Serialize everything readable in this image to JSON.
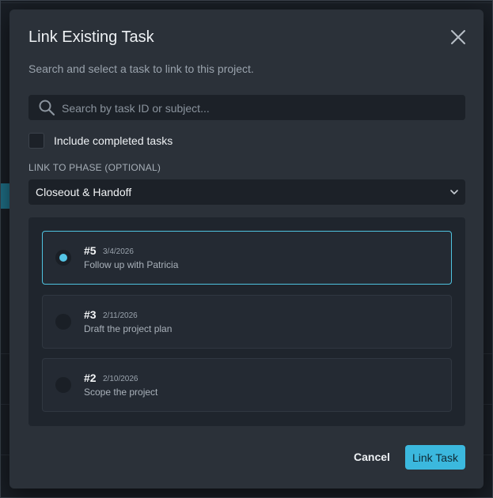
{
  "dialog": {
    "title": "Link Existing Task",
    "subtitle": "Search and select a task to link to this project.",
    "close_icon": "close-icon"
  },
  "search": {
    "placeholder": "Search by task ID or subject...",
    "value": "",
    "icon": "search-icon"
  },
  "include_completed": {
    "label": "Include completed tasks",
    "checked": false
  },
  "phase": {
    "label": "LINK TO PHASE (OPTIONAL)",
    "selected": "Closeout & Handoff",
    "icon": "chevron-down-icon"
  },
  "tasks": [
    {
      "id": "#5",
      "date": "3/4/2026",
      "subject": "Follow up with Patricia",
      "selected": true
    },
    {
      "id": "#3",
      "date": "2/11/2026",
      "subject": "Draft the project plan",
      "selected": false
    },
    {
      "id": "#2",
      "date": "2/10/2026",
      "subject": "Scope the project",
      "selected": false
    }
  ],
  "actions": {
    "cancel_label": "Cancel",
    "link_label": "Link Task"
  },
  "colors": {
    "accent": "#3bb8de",
    "modal_bg": "#2b3139",
    "backdrop": "#191e25"
  }
}
